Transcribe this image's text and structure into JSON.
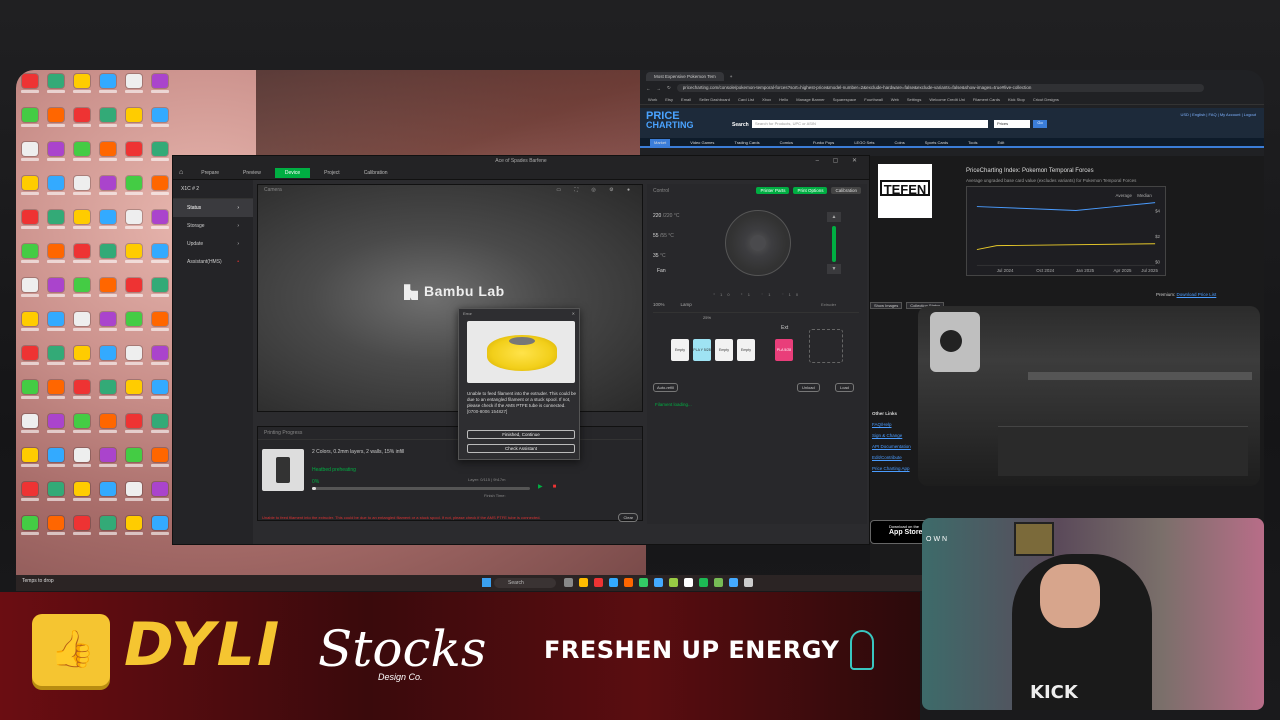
{
  "taskbar": {
    "weather": "Temps to drop",
    "weather_sub": "Next Tuesday",
    "search": "Search"
  },
  "bambu": {
    "window_title": "Ace of Spades Barfene",
    "tabs": [
      "Prepare",
      "Preview",
      "Device",
      "Project",
      "Calibration"
    ],
    "active_tab": "Device",
    "printer_name": "X1C # 2",
    "side_items": [
      "Status",
      "Storage",
      "Update",
      "Assistant(HMS)"
    ],
    "camera_title": "Camera",
    "logo_text": "Bambu Lab",
    "progress_title": "Printing Progress",
    "print_info": "2 Colors, 0.2mm layers, 2 walls, 15% infill",
    "print_status": "Heatbed preheating",
    "print_pct": "0%",
    "progress": 0.02,
    "layer": "Layer: 0/115",
    "eta": "9h17m",
    "finish_time": "Finish Time:",
    "error_line": "Unable to feed filament into the extruder. This could be due to an entangled filament or a stuck spool. If not, please check if the AMS PTFE tube is connected.",
    "clear_label": "Clear",
    "control_title": "Control",
    "printer_parts": "Printer Parts",
    "print_options": "Print Options",
    "calibration": "Calibration",
    "temps": [
      {
        "value": "220",
        "target": "/220 °C"
      },
      {
        "value": "55",
        "target": "/55 °C"
      },
      {
        "value": "35",
        "target": "°C"
      }
    ],
    "fan_label": "Fan",
    "fan_value": "100%",
    "lamp_label": "Lamp",
    "extruder_label": "Extruder",
    "ams_pct": "25%",
    "ams_slots": [
      {
        "label": "Empty",
        "color": "#f2f2f2"
      },
      {
        "label": "PLA Y 5/28",
        "color": "#9fe3f3"
      },
      {
        "label": "Empty",
        "color": "#f2f2f2"
      },
      {
        "label": "Empty",
        "color": "#f2f2f2"
      }
    ],
    "ext_label": "Ext",
    "ext_slot": "PLA 5/28",
    "auto_refill": "Auto-refill",
    "unload": "Unload",
    "load": "Load",
    "ams_status": "Filament loading..."
  },
  "dialog": {
    "title": "Error",
    "message": "Unable to feed filament into the extruder. This could be due to an entangled filament or a stuck spool. If not, please check if the AMS PTFE tube is connected.",
    "code": "[0700-8006 154827]",
    "button_finished": "Finished, Continue",
    "button_assistant": "Check Assistant"
  },
  "browser": {
    "tab_title": "Most Expensive Pokemon Tem",
    "url": "pricecharting.com/console/pokemon-temporal-forces?sort=highest-price&model-number=2&exclude-hardware=false&exclude-variants=false&show-images=true#live-collection",
    "bookmarks": [
      "Work",
      "Etsy",
      "Email",
      "Seller Dashboard",
      "Card List",
      "Xbox",
      "Hello",
      "Manage Banner",
      "Squarespace",
      "Fourthwall",
      "Web",
      "Settings",
      "Welcome Credit Uni",
      "Filament Cards",
      "Kick Stop",
      "Cricut Designs"
    ],
    "logo_top": "PRICE",
    "logo_bottom": "CHARTING",
    "search_label": "Search",
    "search_placeholder": "Search for Products, UPC or ASIN",
    "prices_select": "Prices",
    "go": "Go",
    "user_links": "USD | English | FAQ | My Account | Logout",
    "nav": [
      "Market",
      "Video Games",
      "Trading Cards",
      "Comics",
      "Funko Pops",
      "LEGO Sets",
      "Coins",
      "Sports Cards",
      "Tools",
      "Edit"
    ],
    "page_title": "PriceCharting Index: Pokemon Temporal Forces",
    "page_sub": "Average ungraded base card value (excludes variants) for Pokemon Temporal Forces",
    "chart_legend": [
      "Average",
      "Median"
    ],
    "chart_x": [
      "Jul 2024",
      "Oct 2024",
      "Jan 2025",
      "Apr 2025",
      "Jul 2025"
    ],
    "chart_y": [
      "$4",
      "$2",
      "$0"
    ],
    "premium": "Premium:",
    "premium_link": "Download Price List",
    "show_images": "Show Images",
    "collection_status": "Collection Status",
    "other_links_title": "Other Links",
    "other_links": [
      "FAQ/Help",
      "Sign & Change",
      "API Documentation",
      "Edit/Contribute",
      "Price Charting App"
    ],
    "support_text": "We are user supported. We may earn an affiliate commission.",
    "appstore_small": "Download on the",
    "appstore_big": "App Store"
  },
  "tefen": "TEFEN",
  "webcam": {
    "shirt": "KICK",
    "overlay": "OWN"
  },
  "sponsors": {
    "dyli": "DYLI",
    "stocks": "Stocks",
    "stocks_sub": "Design Co.",
    "freshen": "FRESHEN UP ENERGY"
  }
}
